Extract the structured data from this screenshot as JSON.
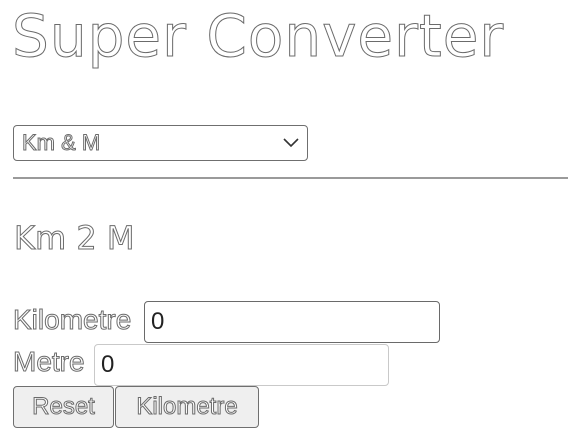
{
  "app": {
    "title": "Super Converter"
  },
  "converter_select": {
    "selected": "Km & M",
    "icon": "chevron-down-icon"
  },
  "section": {
    "title": "Km 2 M"
  },
  "fields": {
    "kilometre_label": "Kilometre",
    "kilometre_value": "0",
    "metre_label": "Metre",
    "metre_value": "0"
  },
  "buttons": {
    "reset_label": "Reset",
    "kilometre_label": "Kilometre"
  },
  "colors": {
    "text_outline": "#6b6b6b",
    "border": "#6f6f6f",
    "button_bg": "#efefef",
    "divider": "#9a9a9a"
  }
}
